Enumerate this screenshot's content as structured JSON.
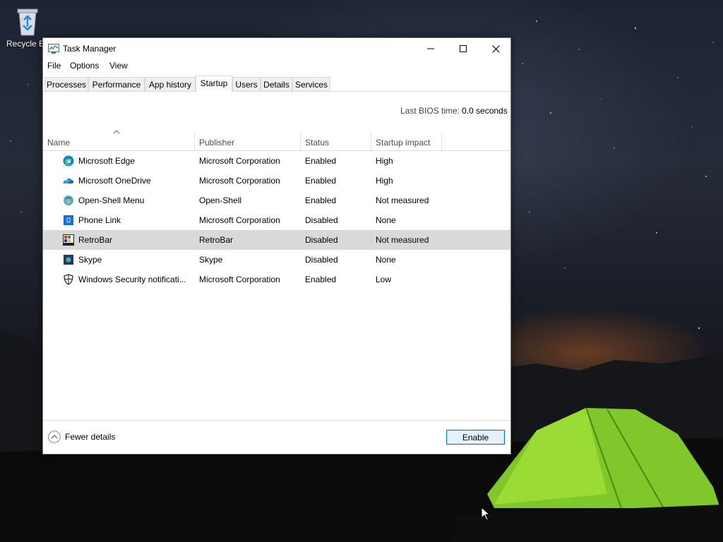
{
  "desktop": {
    "recycle_bin_label": "Recycle Bin"
  },
  "window": {
    "title": "Task Manager",
    "icons": {
      "app": "task-manager-icon",
      "minimize": "minimize-icon",
      "maximize": "maximize-icon",
      "close": "close-icon"
    }
  },
  "menu": [
    "File",
    "Options",
    "View"
  ],
  "tabs": [
    "Processes",
    "Performance",
    "App history",
    "Startup",
    "Users",
    "Details",
    "Services"
  ],
  "active_tab": "Startup",
  "bios": {
    "label": "Last BIOS time:",
    "value": "0.0 seconds"
  },
  "columns": [
    "Name",
    "Publisher",
    "Status",
    "Startup impact"
  ],
  "sort": {
    "column": "Name",
    "direction": "ascending"
  },
  "rows": [
    {
      "name": "Microsoft Edge",
      "publisher": "Microsoft Corporation",
      "status": "Enabled",
      "impact": "High",
      "icon": "edge-icon"
    },
    {
      "name": "Microsoft OneDrive",
      "publisher": "Microsoft Corporation",
      "status": "Enabled",
      "impact": "High",
      "icon": "onedrive-icon"
    },
    {
      "name": "Open-Shell Menu",
      "publisher": "Open-Shell",
      "status": "Enabled",
      "impact": "Not measured",
      "icon": "open-shell-icon"
    },
    {
      "name": "Phone Link",
      "publisher": "Microsoft Corporation",
      "status": "Disabled",
      "impact": "None",
      "icon": "phone-link-icon"
    },
    {
      "name": "RetroBar",
      "publisher": "RetroBar",
      "status": "Disabled",
      "impact": "Not measured",
      "icon": "retrobar-icon",
      "selected": true
    },
    {
      "name": "Skype",
      "publisher": "Skype",
      "status": "Disabled",
      "impact": "None",
      "icon": "skype-icon"
    },
    {
      "name": "Windows Security notificati...",
      "publisher": "Microsoft Corporation",
      "status": "Enabled",
      "impact": "Low",
      "icon": "shield-icon"
    }
  ],
  "footer": {
    "fewer_details": "Fewer details",
    "enable_button": "Enable"
  },
  "colors": {
    "selected_row": "#d9d9d9",
    "button_border": "#0078d7",
    "button_fill": "#e5f1fb"
  }
}
